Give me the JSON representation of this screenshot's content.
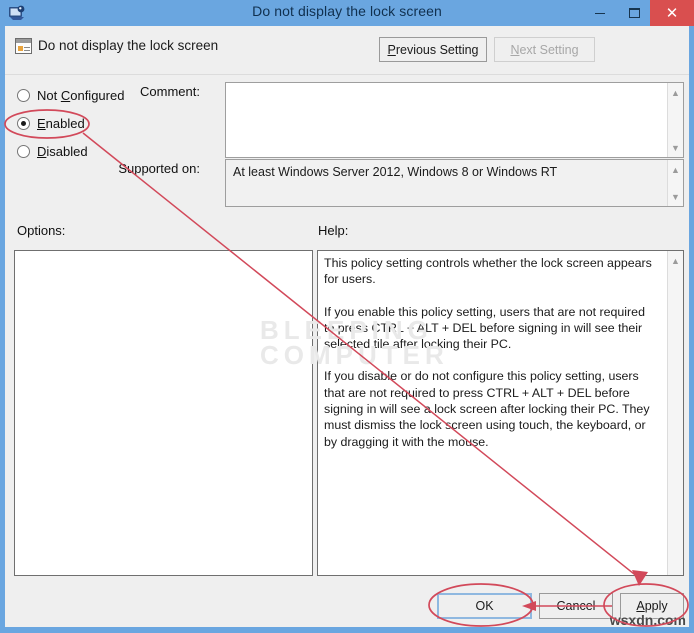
{
  "window": {
    "title": "Do not display the lock screen",
    "icon": "group-policy-icon",
    "caption_buttons": {
      "minimize": "–",
      "maximize": "□",
      "close": "✕"
    }
  },
  "header": {
    "policy_title": "Do not display the lock screen",
    "policy_icon": "policy-setting-icon",
    "previous_setting": "Previous Setting",
    "next_setting": "Next Setting",
    "next_setting_enabled": "false"
  },
  "state": {
    "options": [
      {
        "label": "Not Configured",
        "selected": "false"
      },
      {
        "label": "Enabled",
        "selected": "true"
      },
      {
        "label": "Disabled",
        "selected": "false"
      }
    ],
    "selected": "Enabled"
  },
  "fields": {
    "comment_label": "Comment:",
    "comment_value": "",
    "supported_label": "Supported on:",
    "supported_value": "At least Windows Server 2012, Windows 8 or Windows RT"
  },
  "panels": {
    "options_label": "Options:",
    "options_content": "",
    "help_label": "Help:",
    "help_paragraphs": [
      "This policy setting controls whether the lock screen appears for users.",
      "If you enable this policy setting, users that are not required to press CTRL + ALT + DEL before signing in will see their selected tile after  locking their PC.",
      "If you disable or do not configure this policy setting, users that are not required to press CTRL + ALT + DEL before signing in will see a lock screen after locking their PC. They must dismiss the lock screen using touch, the keyboard, or by dragging it with the mouse."
    ]
  },
  "footer": {
    "ok": "OK",
    "cancel": "Cancel",
    "apply": "Apply"
  },
  "annotations": {
    "color": "#d2495a",
    "ellipse_enabled": "highlight around Enabled radio option",
    "ellipse_ok": "highlight around OK button",
    "ellipse_apply": "highlight around Apply button",
    "arrow_diagonal": "arrow from Enabled to Apply",
    "arrow_horizontal": "arrow from Apply to OK"
  },
  "watermarks": {
    "background": "BLEEPING\nCOMPUTER",
    "site": "wsxdn.com"
  }
}
